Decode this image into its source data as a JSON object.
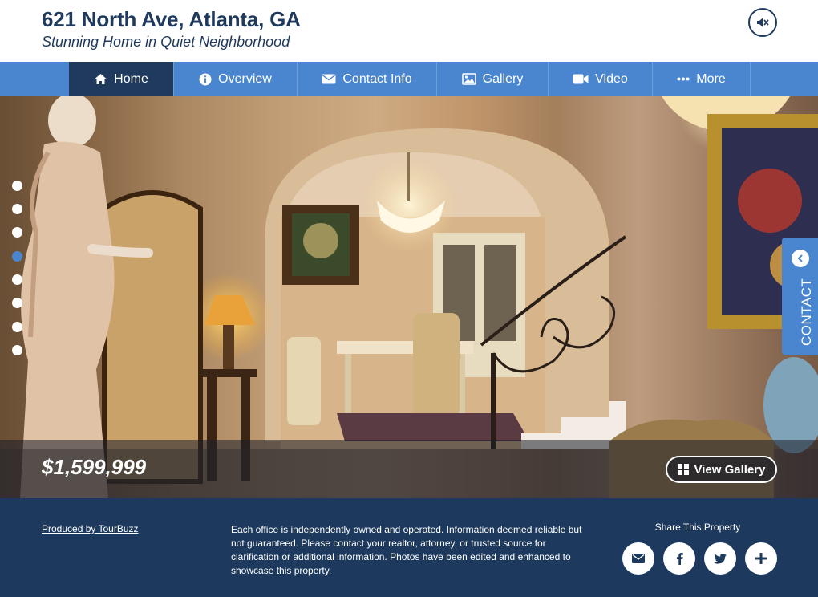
{
  "header": {
    "title": "621 North Ave, Atlanta, GA",
    "subtitle": "Stunning Home in Quiet Neighborhood",
    "mute_icon": "speaker-mute-icon"
  },
  "nav": {
    "items": [
      {
        "label": "Home",
        "icon": "home-icon",
        "active": true
      },
      {
        "label": "Overview",
        "icon": "info-icon",
        "active": false
      },
      {
        "label": "Contact Info",
        "icon": "envelope-icon",
        "active": false
      },
      {
        "label": "Gallery",
        "icon": "image-icon",
        "active": false
      },
      {
        "label": "Video",
        "icon": "video-camera-icon",
        "active": false
      },
      {
        "label": "More",
        "icon": "ellipsis-icon",
        "active": false
      }
    ]
  },
  "hero": {
    "price": "$1,599,999",
    "view_gallery_label": "View Gallery",
    "slide_count": 8,
    "active_slide": 4,
    "contact_tab_label": "CONTACT"
  },
  "footer": {
    "produced_by": "Produced by TourBuzz",
    "disclaimer": "Each office is independently owned and operated. Information deemed reliable but not guaranteed. Please contact your realtor, attorney, or trusted source for clarification or additional information. Photos have been edited and enhanced to showcase this property.",
    "share_title": "Share This Property",
    "share_buttons": [
      "envelope-icon",
      "facebook-icon",
      "twitter-icon",
      "plus-icon"
    ]
  },
  "colors": {
    "navy": "#1f3a5c",
    "accent_blue": "#4a86cf",
    "footer_bg": "#1d3a5e"
  }
}
